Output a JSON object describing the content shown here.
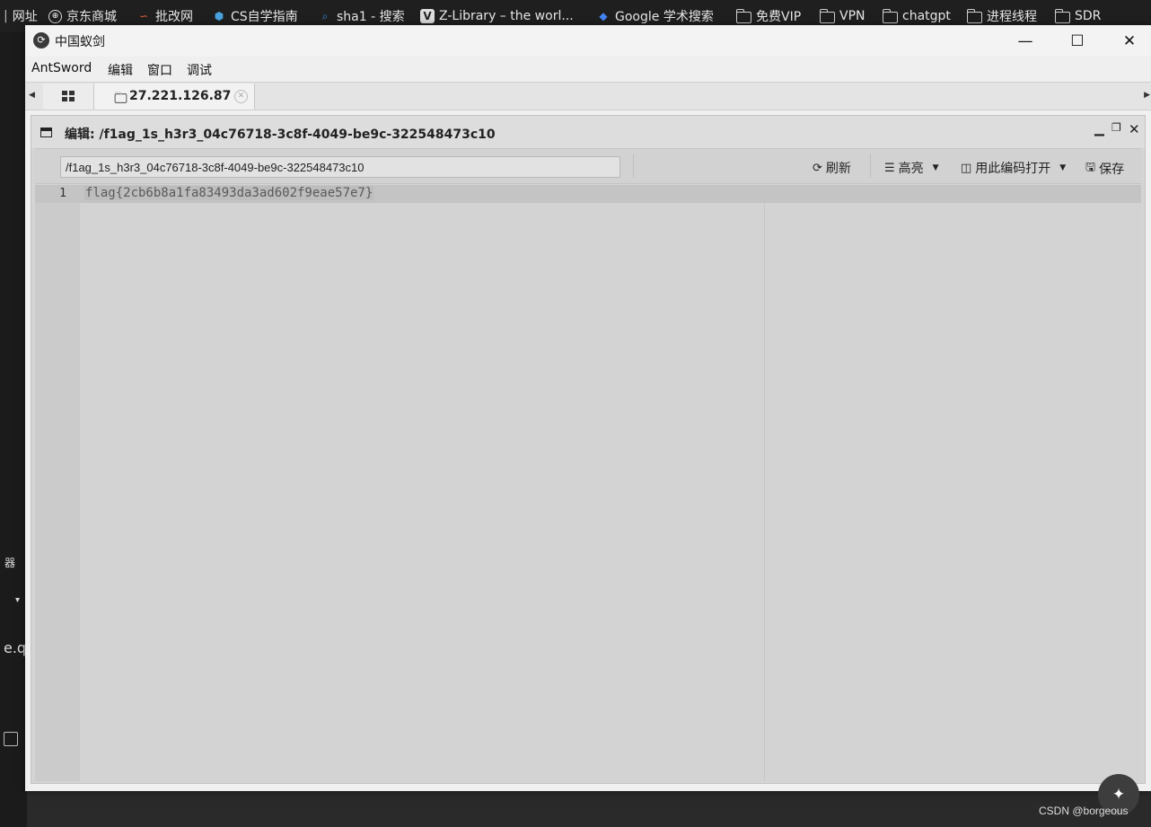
{
  "bookmarks": [
    {
      "label": "网址",
      "icon": "bookmark-icon"
    },
    {
      "label": "京东商城",
      "icon": "globe-icon"
    },
    {
      "label": "批改网",
      "icon": "pigai-icon"
    },
    {
      "label": "CS自学指南",
      "icon": "cube-icon"
    },
    {
      "label": "sha1 - 搜索",
      "icon": "search-icon"
    },
    {
      "label": "Z-Library – the worl...",
      "icon": "zlibrary-icon"
    },
    {
      "label": "Google 学术搜索",
      "icon": "scholar-icon"
    },
    {
      "label": "免费VIP",
      "icon": "folder-icon"
    },
    {
      "label": "VPN",
      "icon": "folder-icon"
    },
    {
      "label": "chatgpt",
      "icon": "folder-icon"
    },
    {
      "label": "进程线程",
      "icon": "folder-icon"
    },
    {
      "label": "SDR",
      "icon": "folder-icon"
    }
  ],
  "background_app": {
    "label_1": "器",
    "label_2": "e.q",
    "dropdown": "▾"
  },
  "window": {
    "title": "中国蚁剑",
    "controls": {
      "minimize": "—",
      "maximize": "☐",
      "close": "✕"
    }
  },
  "menu": [
    "AntSword",
    "编辑",
    "窗口",
    "调试"
  ],
  "tabs": {
    "host_label": "27.221.126.87"
  },
  "editor_panel": {
    "title": "编辑: /f1ag_1s_h3r3_04c76718-3c8f-4049-be9c-322548473c10",
    "path_value": "/f1ag_1s_h3r3_04c76718-3c8f-4049-be9c-322548473c10",
    "toolbar": {
      "refresh": "刷新",
      "highlight": "高亮",
      "open_with_encoding": "用此编码打开",
      "save": "保存"
    },
    "lines": [
      {
        "number": "1",
        "text": "flag{2cb6b8a1fa83493da3ad602f9eae57e7}"
      }
    ]
  },
  "watermark": "CSDN @borgeous"
}
